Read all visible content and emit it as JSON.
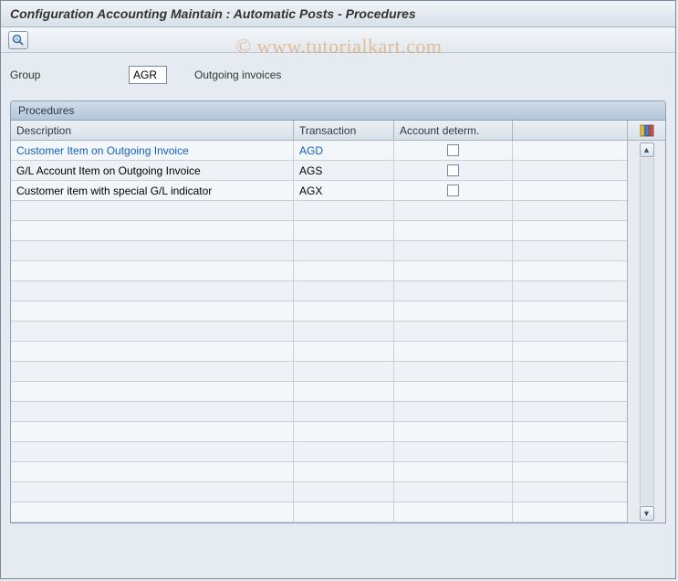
{
  "title": "Configuration Accounting Maintain : Automatic Posts - Procedures",
  "watermark": "© www.tutorialkart.com",
  "group": {
    "label": "Group",
    "value": "AGR",
    "description": "Outgoing invoices"
  },
  "panel": {
    "title": "Procedures",
    "columns": {
      "description": "Description",
      "transaction": "Transaction",
      "account_determ": "Account determ."
    },
    "rows": [
      {
        "description": "Customer Item on Outgoing Invoice",
        "transaction": "AGD",
        "account_determ": false,
        "link": true
      },
      {
        "description": "G/L Account Item on Outgoing Invoice",
        "transaction": "AGS",
        "account_determ": false,
        "link": false
      },
      {
        "description": "Customer item with special G/L indicator",
        "transaction": "AGX",
        "account_determ": false,
        "link": false
      }
    ],
    "empty_rows": 16
  }
}
